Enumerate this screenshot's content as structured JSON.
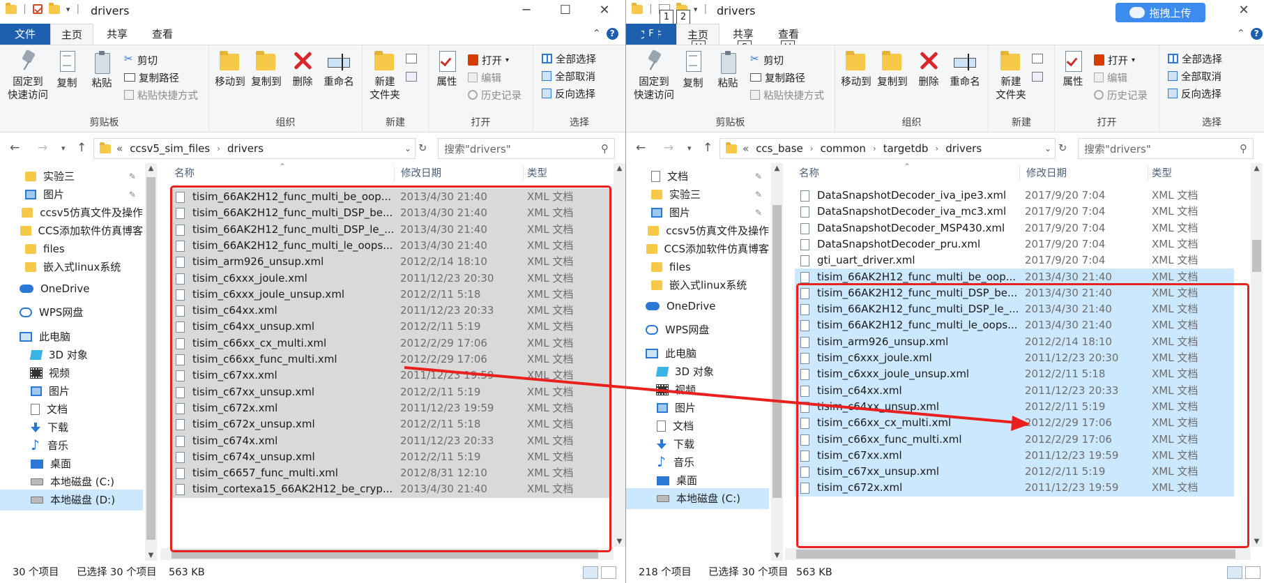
{
  "accent": "#1f5fb0",
  "highlight_box_color": "#e8201e",
  "left": {
    "title": "drivers",
    "tabs": {
      "file": "文件",
      "home": "主页",
      "share": "共享",
      "view": "查看"
    },
    "ribbon": {
      "pin": "固定到\n快速访问",
      "copy": "复制",
      "paste": "粘贴",
      "cut": "剪切",
      "copy_path": "复制路径",
      "paste_shortcut": "粘贴快捷方式",
      "move_to": "移动到",
      "copy_to": "复制到",
      "delete": "删除",
      "rename": "重命名",
      "new_folder": "新建\n文件夹",
      "properties": "属性",
      "open": "打开",
      "edit": "编辑",
      "history": "历史记录",
      "select_all": "全部选择",
      "select_none": "全部取消",
      "invert": "反向选择",
      "grp_clipboard": "剪贴板",
      "grp_organize": "组织",
      "grp_new": "新建",
      "grp_open": "打开",
      "grp_select": "选择"
    },
    "address": {
      "overflow": "«",
      "crumbs": [
        "ccsv5_sim_files",
        "drivers"
      ]
    },
    "search_placeholder": "搜索\"drivers\"",
    "nav": [
      {
        "label": "实验三",
        "icon": "folder-icon",
        "pinned": true
      },
      {
        "label": "图片",
        "icon": "pictures-icon",
        "pinned": true
      },
      {
        "label": "ccsv5仿真文件及操作",
        "icon": "folder-icon"
      },
      {
        "label": "CCS添加软件仿真博客",
        "icon": "folder-icon"
      },
      {
        "label": "files",
        "icon": "folder-icon"
      },
      {
        "label": "嵌入式linux系统",
        "icon": "folder-icon"
      },
      {
        "label": "OneDrive",
        "icon": "cloud-icon"
      },
      {
        "label": "WPS网盘",
        "icon": "wps-cloud-icon"
      },
      {
        "label": "此电脑",
        "icon": "computer-icon"
      },
      {
        "label": "3D 对象",
        "icon": "3d-objects-icon"
      },
      {
        "label": "视频",
        "icon": "video-icon"
      },
      {
        "label": "图片",
        "icon": "pictures-icon"
      },
      {
        "label": "文档",
        "icon": "documents-icon"
      },
      {
        "label": "下载",
        "icon": "download-icon"
      },
      {
        "label": "音乐",
        "icon": "music-icon"
      },
      {
        "label": "桌面",
        "icon": "desktop-icon"
      },
      {
        "label": "本地磁盘 (C:)",
        "icon": "drive-icon"
      },
      {
        "label": "本地磁盘 (D:)",
        "icon": "drive-icon",
        "selected": true
      }
    ],
    "columns": {
      "name": "名称",
      "date": "修改日期",
      "type": "类型"
    },
    "files": [
      {
        "name": "tisim_66AK2H12_func_multi_be_oop...",
        "date": "2013/4/30 21:40",
        "type": "XML 文档"
      },
      {
        "name": "tisim_66AK2H12_func_multi_DSP_be...",
        "date": "2013/4/30 21:40",
        "type": "XML 文档"
      },
      {
        "name": "tisim_66AK2H12_func_multi_DSP_le_...",
        "date": "2013/4/30 21:40",
        "type": "XML 文档"
      },
      {
        "name": "tisim_66AK2H12_func_multi_le_oops...",
        "date": "2013/4/30 21:40",
        "type": "XML 文档"
      },
      {
        "name": "tisim_arm926_unsup.xml",
        "date": "2012/2/14 18:10",
        "type": "XML 文档"
      },
      {
        "name": "tisim_c6xxx_joule.xml",
        "date": "2011/12/23 20:30",
        "type": "XML 文档"
      },
      {
        "name": "tisim_c6xxx_joule_unsup.xml",
        "date": "2012/2/11 5:18",
        "type": "XML 文档"
      },
      {
        "name": "tisim_c64xx.xml",
        "date": "2011/12/23 20:33",
        "type": "XML 文档"
      },
      {
        "name": "tisim_c64xx_unsup.xml",
        "date": "2012/2/11 5:19",
        "type": "XML 文档"
      },
      {
        "name": "tisim_c66xx_cx_multi.xml",
        "date": "2012/2/29 17:06",
        "type": "XML 文档"
      },
      {
        "name": "tisim_c66xx_func_multi.xml",
        "date": "2012/2/29 17:06",
        "type": "XML 文档"
      },
      {
        "name": "tisim_c67xx.xml",
        "date": "2011/12/23 19:59",
        "type": "XML 文档"
      },
      {
        "name": "tisim_c67xx_unsup.xml",
        "date": "2012/2/11 5:19",
        "type": "XML 文档"
      },
      {
        "name": "tisim_c672x.xml",
        "date": "2011/12/23 19:59",
        "type": "XML 文档"
      },
      {
        "name": "tisim_c672x_unsup.xml",
        "date": "2012/2/11 5:18",
        "type": "XML 文档"
      },
      {
        "name": "tisim_c674x.xml",
        "date": "2011/12/23 20:33",
        "type": "XML 文档"
      },
      {
        "name": "tisim_c674x_unsup.xml",
        "date": "2012/2/11 5:19",
        "type": "XML 文档"
      },
      {
        "name": "tisim_c6657_func_multi.xml",
        "date": "2012/8/31 12:10",
        "type": "XML 文档"
      },
      {
        "name": "tisim_cortexa15_66AK2H12_be_cryp...",
        "date": "2013/4/30 21:40",
        "type": "XML 文档"
      }
    ],
    "status": {
      "count": "30 个项目",
      "selected": "已选择 30 个项目",
      "size": "563 KB"
    }
  },
  "right": {
    "title": "drivers",
    "upload_label": "拖拽上传",
    "keytips": [
      "1",
      "2",
      "F",
      "H",
      "S",
      "V"
    ],
    "tabs": {
      "file": "文件",
      "home": "主页",
      "share": "共享",
      "view": "查看"
    },
    "ribbon": {
      "pin": "固定到\n快速访问",
      "copy": "复制",
      "paste": "粘贴",
      "cut": "剪切",
      "copy_path": "复制路径",
      "paste_shortcut": "粘贴快捷方式",
      "move_to": "移动到",
      "copy_to": "复制到",
      "delete": "删除",
      "rename": "重命名",
      "new_folder": "新建\n文件夹",
      "properties": "属性",
      "open": "打开",
      "edit": "编辑",
      "history": "历史记录",
      "select_all": "全部选择",
      "select_none": "全部取消",
      "invert": "反向选择",
      "grp_clipboard": "剪贴板",
      "grp_organize": "组织",
      "grp_new": "新建",
      "grp_open": "打开",
      "grp_select": "选择"
    },
    "address": {
      "overflow": "«",
      "crumbs": [
        "ccs_base",
        "common",
        "targetdb",
        "drivers"
      ]
    },
    "search_placeholder": "搜索\"drivers\"",
    "nav": [
      {
        "label": "文档",
        "icon": "documents-icon",
        "pinned": true
      },
      {
        "label": "实验三",
        "icon": "folder-icon",
        "pinned": true
      },
      {
        "label": "图片",
        "icon": "pictures-icon",
        "pinned": true
      },
      {
        "label": "ccsv5仿真文件及操作",
        "icon": "folder-icon"
      },
      {
        "label": "CCS添加软件仿真博客",
        "icon": "folder-icon"
      },
      {
        "label": "files",
        "icon": "folder-icon"
      },
      {
        "label": "嵌入式linux系统",
        "icon": "folder-icon"
      },
      {
        "label": "OneDrive",
        "icon": "cloud-icon"
      },
      {
        "label": "WPS网盘",
        "icon": "wps-cloud-icon"
      },
      {
        "label": "此电脑",
        "icon": "computer-icon"
      },
      {
        "label": "3D 对象",
        "icon": "3d-objects-icon"
      },
      {
        "label": "视频",
        "icon": "video-icon"
      },
      {
        "label": "图片",
        "icon": "pictures-icon"
      },
      {
        "label": "文档",
        "icon": "documents-icon"
      },
      {
        "label": "下载",
        "icon": "download-icon"
      },
      {
        "label": "音乐",
        "icon": "music-icon"
      },
      {
        "label": "桌面",
        "icon": "desktop-icon"
      },
      {
        "label": "本地磁盘 (C:)",
        "icon": "drive-icon",
        "selected": true
      }
    ],
    "columns": {
      "name": "名称",
      "date": "修改日期",
      "type": "类型"
    },
    "files": [
      {
        "name": "DataSnapshotDecoder_iva_ipe3.xml",
        "date": "2017/9/20 7:04",
        "type": "XML 文档"
      },
      {
        "name": "DataSnapshotDecoder_iva_mc3.xml",
        "date": "2017/9/20 7:04",
        "type": "XML 文档"
      },
      {
        "name": "DataSnapshotDecoder_MSP430.xml",
        "date": "2017/9/20 7:04",
        "type": "XML 文档"
      },
      {
        "name": "DataSnapshotDecoder_pru.xml",
        "date": "2017/9/20 7:04",
        "type": "XML 文档"
      },
      {
        "name": "gti_uart_driver.xml",
        "date": "2017/9/20 7:04",
        "type": "XML 文档"
      },
      {
        "name": "tisim_66AK2H12_func_multi_be_oop...",
        "date": "2013/4/30 21:40",
        "type": "XML 文档",
        "selected": true
      },
      {
        "name": "tisim_66AK2H12_func_multi_DSP_be...",
        "date": "2013/4/30 21:40",
        "type": "XML 文档",
        "selected": true
      },
      {
        "name": "tisim_66AK2H12_func_multi_DSP_le_...",
        "date": "2013/4/30 21:40",
        "type": "XML 文档",
        "selected": true
      },
      {
        "name": "tisim_66AK2H12_func_multi_le_oops...",
        "date": "2013/4/30 21:40",
        "type": "XML 文档",
        "selected": true
      },
      {
        "name": "tisim_arm926_unsup.xml",
        "date": "2012/2/14 18:10",
        "type": "XML 文档",
        "selected": true
      },
      {
        "name": "tisim_c6xxx_joule.xml",
        "date": "2011/12/23 20:30",
        "type": "XML 文档",
        "selected": true
      },
      {
        "name": "tisim_c6xxx_joule_unsup.xml",
        "date": "2012/2/11 5:18",
        "type": "XML 文档",
        "selected": true
      },
      {
        "name": "tisim_c64xx.xml",
        "date": "2011/12/23 20:33",
        "type": "XML 文档",
        "selected": true
      },
      {
        "name": "tisim_c64xx_unsup.xml",
        "date": "2012/2/11 5:19",
        "type": "XML 文档",
        "selected": true
      },
      {
        "name": "tisim_c66xx_cx_multi.xml",
        "date": "2012/2/29 17:06",
        "type": "XML 文档",
        "selected": true
      },
      {
        "name": "tisim_c66xx_func_multi.xml",
        "date": "2012/2/29 17:06",
        "type": "XML 文档",
        "selected": true
      },
      {
        "name": "tisim_c67xx.xml",
        "date": "2011/12/23 19:59",
        "type": "XML 文档",
        "selected": true
      },
      {
        "name": "tisim_c67xx_unsup.xml",
        "date": "2012/2/11 5:19",
        "type": "XML 文档",
        "selected": true
      },
      {
        "name": "tisim_c672x.xml",
        "date": "2011/12/23 19:59",
        "type": "XML 文档",
        "selected": true
      }
    ],
    "status": {
      "count": "218 个项目",
      "selected": "已选择 30 个项目",
      "size": "563 KB"
    }
  }
}
